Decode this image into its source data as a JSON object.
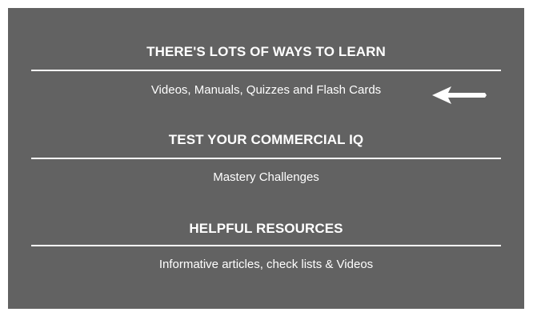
{
  "sections": [
    {
      "heading": "THERE'S LOTS OF WAYS TO LEARN",
      "link": "Videos, Manuals, Quizzes and Flash Cards"
    },
    {
      "heading": "TEST YOUR COMMERCIAL IQ",
      "link": "Mastery Challenges"
    },
    {
      "heading": "HELPFUL RESOURCES",
      "link": "Informative articles, check lists & Videos"
    }
  ],
  "colors": {
    "panel_background": "#626262",
    "text": "#ffffff",
    "page_background": "#ffffff"
  },
  "icons": {
    "pointer": "arrow-left-icon"
  }
}
